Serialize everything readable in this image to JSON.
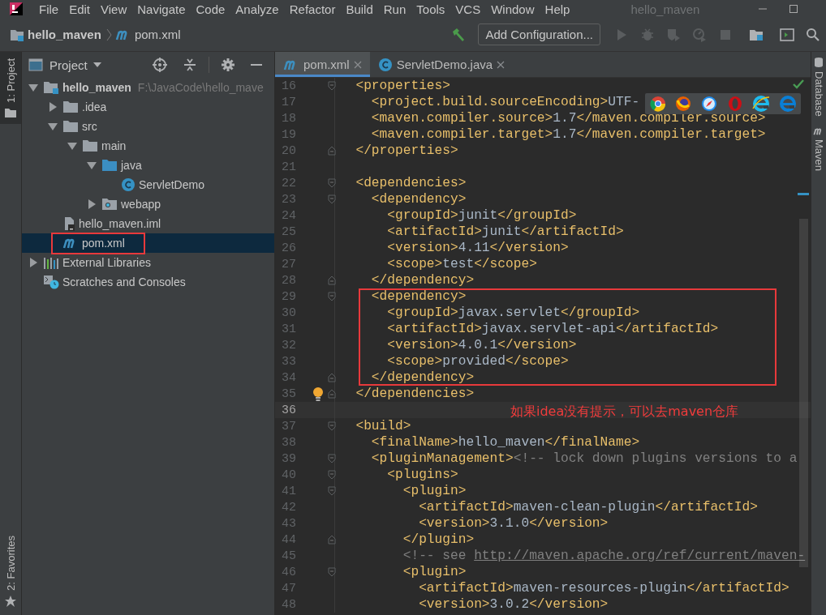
{
  "title_bar": {
    "menu": [
      "File",
      "Edit",
      "View",
      "Navigate",
      "Code",
      "Analyze",
      "Refactor",
      "Build",
      "Run",
      "Tools",
      "VCS",
      "Window",
      "Help"
    ],
    "title": "hello_maven"
  },
  "nav_bar": {
    "breadcrumbs": [
      {
        "label": "hello_maven",
        "kind": "module"
      },
      {
        "label": "pom.xml",
        "kind": "maven"
      }
    ],
    "run_config": "Add Configuration..."
  },
  "left_tool_tabs": [
    {
      "label": "1: Project",
      "selected": true
    },
    {
      "label": "2: Favorites",
      "selected": false
    }
  ],
  "project_panel": {
    "title": "Project",
    "tree": [
      {
        "label": "hello_maven",
        "path": "F:\\JavaCode\\hello_mave",
        "kind": "module",
        "expanded": true,
        "selected": false,
        "children": [
          {
            "label": ".idea",
            "kind": "folder",
            "expanded": false,
            "selected": false
          },
          {
            "label": "src",
            "kind": "folder",
            "expanded": true,
            "selected": false,
            "children": [
              {
                "label": "main",
                "kind": "folder",
                "expanded": true,
                "selected": false,
                "children": [
                  {
                    "label": "java",
                    "kind": "source-folder",
                    "expanded": true,
                    "selected": false,
                    "children": [
                      {
                        "label": "ServletDemo",
                        "kind": "class",
                        "selected": false
                      }
                    ]
                  },
                  {
                    "label": "webapp",
                    "kind": "web-folder",
                    "expanded": false,
                    "selected": false
                  }
                ]
              }
            ]
          },
          {
            "label": "hello_maven.iml",
            "kind": "iml-file",
            "selected": false
          },
          {
            "label": "pom.xml",
            "kind": "maven",
            "selected": true,
            "highlighted": true
          }
        ]
      },
      {
        "label": "External Libraries",
        "kind": "libraries",
        "expanded": false,
        "selected": false
      },
      {
        "label": "Scratches and Consoles",
        "kind": "scratches",
        "selected": false
      }
    ]
  },
  "editor": {
    "tabs": [
      {
        "label": "pom.xml",
        "kind": "maven",
        "selected": true
      },
      {
        "label": "ServletDemo.java",
        "kind": "class",
        "selected": false
      }
    ],
    "lines": [
      {
        "number": "16",
        "fold_open": true,
        "segments": [
          {
            "kind": "tag",
            "text": "  <properties>"
          }
        ]
      },
      {
        "number": "17",
        "segments": [
          {
            "kind": "tag",
            "text": "    <project.build.sourceEncoding>"
          },
          {
            "kind": "text",
            "text": "UTF-"
          }
        ]
      },
      {
        "number": "18",
        "segments": [
          {
            "kind": "tag",
            "text": "    <maven.compiler.source>"
          },
          {
            "kind": "text",
            "text": "1.7"
          },
          {
            "kind": "tag",
            "text": "</maven.compiler.source>"
          }
        ]
      },
      {
        "number": "19",
        "segments": [
          {
            "kind": "tag",
            "text": "    <maven.compiler.target>"
          },
          {
            "kind": "text",
            "text": "1.7"
          },
          {
            "kind": "tag",
            "text": "</maven.compiler.target>"
          }
        ]
      },
      {
        "number": "20",
        "fold_close": true,
        "segments": [
          {
            "kind": "tag",
            "text": "  </properties>"
          }
        ]
      },
      {
        "number": "21"
      },
      {
        "number": "22",
        "fold_open": true,
        "segments": [
          {
            "kind": "tag",
            "text": "  <dependencies>"
          }
        ]
      },
      {
        "number": "23",
        "fold_open": true,
        "segments": [
          {
            "kind": "tag",
            "text": "    <dependency>"
          }
        ]
      },
      {
        "number": "24",
        "segments": [
          {
            "kind": "tag",
            "text": "      <groupId>"
          },
          {
            "kind": "text",
            "text": "junit"
          },
          {
            "kind": "tag",
            "text": "</groupId>"
          }
        ]
      },
      {
        "number": "25",
        "segments": [
          {
            "kind": "tag",
            "text": "      <artifactId>"
          },
          {
            "kind": "text",
            "text": "junit"
          },
          {
            "kind": "tag",
            "text": "</artifactId>"
          }
        ]
      },
      {
        "number": "26",
        "segments": [
          {
            "kind": "tag",
            "text": "      <version>"
          },
          {
            "kind": "text",
            "text": "4.11"
          },
          {
            "kind": "tag",
            "text": "</version>"
          }
        ]
      },
      {
        "number": "27",
        "segments": [
          {
            "kind": "tag",
            "text": "      <scope>"
          },
          {
            "kind": "text",
            "text": "test"
          },
          {
            "kind": "tag",
            "text": "</scope>"
          }
        ]
      },
      {
        "number": "28",
        "fold_close": true,
        "segments": [
          {
            "kind": "tag",
            "text": "    </dependency>"
          }
        ]
      },
      {
        "number": "29",
        "fold_open": true,
        "boxed": true,
        "segments": [
          {
            "kind": "tag",
            "text": "    <dependency>"
          }
        ]
      },
      {
        "number": "30",
        "boxed": true,
        "segments": [
          {
            "kind": "tag",
            "text": "      <groupId>"
          },
          {
            "kind": "text",
            "text": "javax.servlet"
          },
          {
            "kind": "tag",
            "text": "</groupId>"
          }
        ]
      },
      {
        "number": "31",
        "boxed": true,
        "segments": [
          {
            "kind": "tag",
            "text": "      <artifactId>"
          },
          {
            "kind": "text",
            "text": "javax.servlet-api"
          },
          {
            "kind": "tag",
            "text": "</artifactId>"
          }
        ]
      },
      {
        "number": "32",
        "boxed": true,
        "segments": [
          {
            "kind": "tag",
            "text": "      <version>"
          },
          {
            "kind": "text",
            "text": "4.0.1"
          },
          {
            "kind": "tag",
            "text": "</version>"
          }
        ]
      },
      {
        "number": "33",
        "boxed": true,
        "segments": [
          {
            "kind": "tag",
            "text": "      <scope>"
          },
          {
            "kind": "text",
            "text": "provided"
          },
          {
            "kind": "tag",
            "text": "</scope>"
          }
        ]
      },
      {
        "number": "34",
        "fold_close": true,
        "boxed": true,
        "segments": [
          {
            "kind": "tag",
            "text": "    </dependency>"
          }
        ]
      },
      {
        "number": "35",
        "fold_close": true,
        "bulb": true,
        "segments": [
          {
            "kind": "tag",
            "text": "  </dependencies>"
          }
        ]
      },
      {
        "number": "36",
        "current": true,
        "note": "如果idea没有提示，可以去maven仓库"
      },
      {
        "number": "37",
        "fold_open": true,
        "segments": [
          {
            "kind": "tag",
            "text": "  <build>"
          }
        ]
      },
      {
        "number": "38",
        "segments": [
          {
            "kind": "tag",
            "text": "    <finalName>"
          },
          {
            "kind": "text",
            "text": "hello_maven"
          },
          {
            "kind": "tag",
            "text": "</finalName>"
          }
        ]
      },
      {
        "number": "39",
        "fold_open": true,
        "segments": [
          {
            "kind": "tag",
            "text": "    <pluginManagement>"
          },
          {
            "kind": "comment",
            "text": "<!-- lock down plugins versions to a"
          }
        ]
      },
      {
        "number": "40",
        "fold_open": true,
        "segments": [
          {
            "kind": "tag",
            "text": "      <plugins>"
          }
        ]
      },
      {
        "number": "41",
        "fold_open": true,
        "segments": [
          {
            "kind": "tag",
            "text": "        <plugin>"
          }
        ]
      },
      {
        "number": "42",
        "segments": [
          {
            "kind": "tag",
            "text": "          <artifactId>"
          },
          {
            "kind": "text",
            "text": "maven-clean-plugin"
          },
          {
            "kind": "tag",
            "text": "</artifactId>"
          }
        ]
      },
      {
        "number": "43",
        "segments": [
          {
            "kind": "tag",
            "text": "          <version>"
          },
          {
            "kind": "text",
            "text": "3.1.0"
          },
          {
            "kind": "tag",
            "text": "</version>"
          }
        ]
      },
      {
        "number": "44",
        "fold_close": true,
        "segments": [
          {
            "kind": "tag",
            "text": "        </plugin>"
          }
        ]
      },
      {
        "number": "45",
        "segments": [
          {
            "kind": "comment",
            "text": "        <!-- see "
          },
          {
            "kind": "link",
            "text": "http://maven.apache.org/ref/current/maven-"
          }
        ]
      },
      {
        "number": "46",
        "fold_open": true,
        "segments": [
          {
            "kind": "tag",
            "text": "        <plugin>"
          }
        ]
      },
      {
        "number": "47",
        "segments": [
          {
            "kind": "tag",
            "text": "          <artifactId>"
          },
          {
            "kind": "text",
            "text": "maven-resources-plugin"
          },
          {
            "kind": "tag",
            "text": "</artifactId>"
          }
        ]
      },
      {
        "number": "48",
        "segments": [
          {
            "kind": "tag",
            "text": "          <version>"
          },
          {
            "kind": "text",
            "text": "3.0.2"
          },
          {
            "kind": "tag",
            "text": "</version>"
          }
        ]
      }
    ]
  },
  "right_tool_tabs": [
    {
      "label": "Database",
      "kind": "database"
    },
    {
      "label": "Maven",
      "kind": "maven"
    }
  ]
}
